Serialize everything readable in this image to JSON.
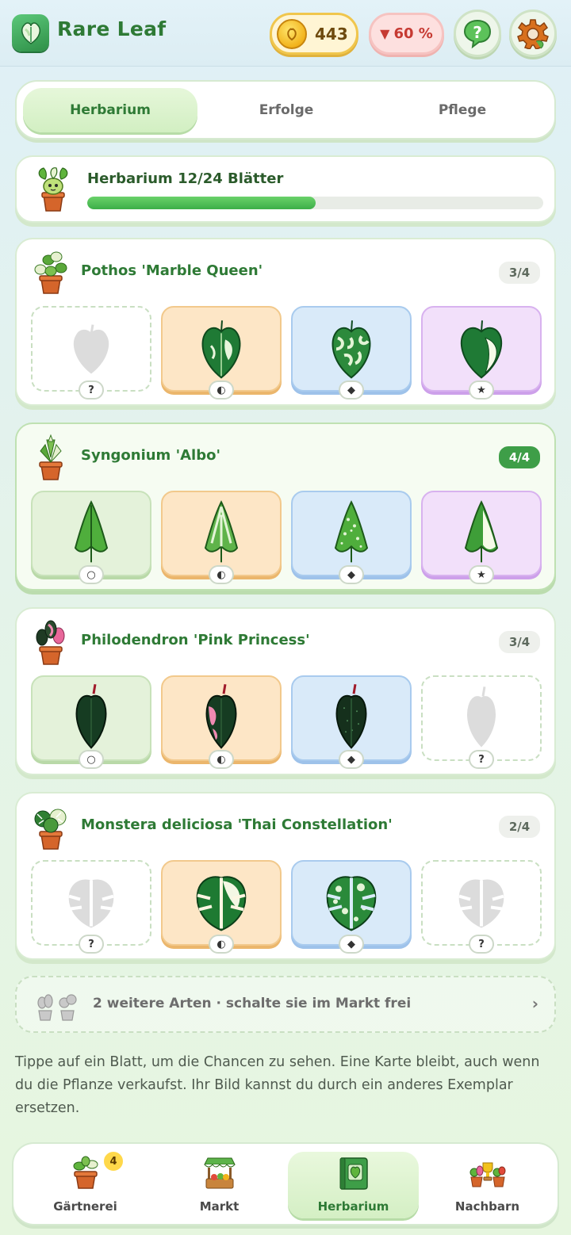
{
  "app": {
    "title": "Rare Leaf",
    "coins": "443",
    "rate": "60 %",
    "rate_arrow": "▼",
    "help_symbol": "?"
  },
  "tabs": [
    {
      "label": "Herbarium",
      "active": true
    },
    {
      "label": "Erfolge",
      "active": false
    },
    {
      "label": "Pflege",
      "active": false
    }
  ],
  "progress": {
    "title": "Herbarium 12/24 Blätter",
    "fraction": 0.5
  },
  "plants": [
    {
      "name": "Pothos 'Marble Queen'",
      "count": "3/4",
      "slots": [
        {
          "rarity": "empty",
          "chip": "?"
        },
        {
          "rarity": "uncommon",
          "chip": "◐"
        },
        {
          "rarity": "rare",
          "chip": "◆"
        },
        {
          "rarity": "epic",
          "chip": "★"
        }
      ]
    },
    {
      "name": "Syngonium 'Albo'",
      "count": "4/4",
      "slots": [
        {
          "rarity": "common",
          "chip": "○"
        },
        {
          "rarity": "uncommon",
          "chip": "◐"
        },
        {
          "rarity": "rare",
          "chip": "◆"
        },
        {
          "rarity": "epic",
          "chip": "★"
        }
      ]
    },
    {
      "name": "Philodendron 'Pink Princess'",
      "count": "3/4",
      "slots": [
        {
          "rarity": "common",
          "chip": "○"
        },
        {
          "rarity": "uncommon",
          "chip": "◐"
        },
        {
          "rarity": "rare",
          "chip": "◆"
        },
        {
          "rarity": "empty",
          "chip": "?"
        }
      ]
    },
    {
      "name": "Monstera deliciosa 'Thai Constellation'",
      "count": "2/4",
      "slots": [
        {
          "rarity": "empty",
          "chip": "?"
        },
        {
          "rarity": "uncommon",
          "chip": "◐"
        },
        {
          "rarity": "rare",
          "chip": "◆"
        },
        {
          "rarity": "empty",
          "chip": "?"
        }
      ]
    }
  ],
  "locked": {
    "text": "2 weitere Arten · schalte sie im Markt frei",
    "chevron": "›"
  },
  "hint": "Tippe auf ein Blatt, um die Chancen zu sehen. Eine Karte bleibt, auch wenn du die Pflanze verkaufst. Ihr Bild kannst du durch ein anderes Exemplar ersetzen.",
  "nav": [
    {
      "label": "Gärtnerei",
      "badge": "4",
      "icon": "plant-pot-icon"
    },
    {
      "label": "Markt",
      "icon": "market-stall-icon"
    },
    {
      "label": "Herbarium",
      "icon": "herbarium-book-icon",
      "active": true
    },
    {
      "label": "Nachbarn",
      "icon": "neighbors-icon"
    }
  ]
}
